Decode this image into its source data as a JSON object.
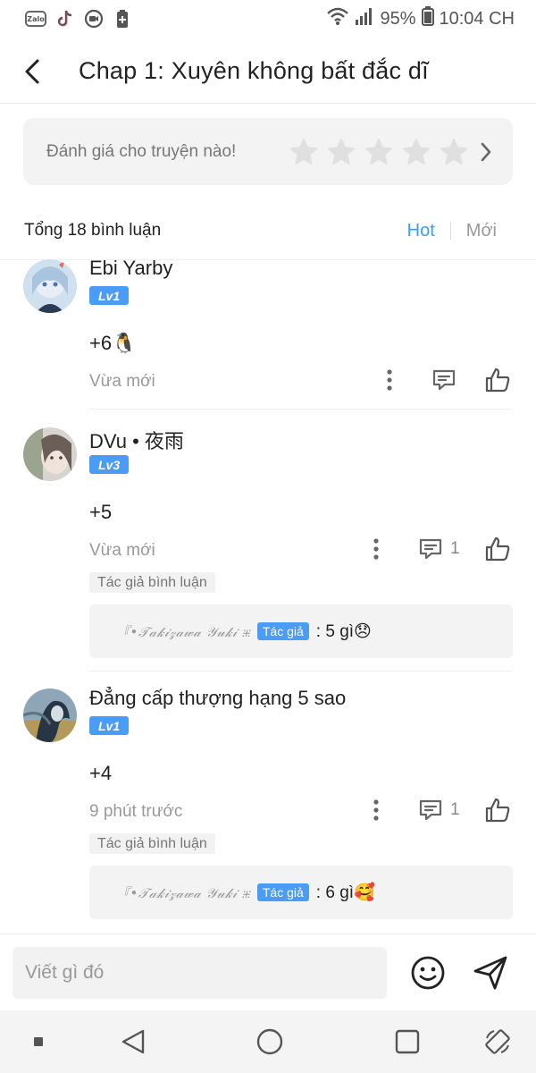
{
  "status_bar": {
    "zalo_label": "Zalo",
    "battery": "95%",
    "time": "10:04 CH"
  },
  "header": {
    "title": "Chap 1: Xuyên không bất đắc dĩ"
  },
  "rating": {
    "prompt": "Đánh giá cho truyện nào!",
    "stars_filled": 0,
    "stars_total": 5,
    "star_color": "#e0e0e0"
  },
  "comments_header": {
    "total_label": "Tổng 18 bình luận",
    "tabs": [
      {
        "label": "Hot",
        "active": true
      },
      {
        "label": "Mới",
        "active": false
      }
    ]
  },
  "comments": [
    {
      "name": "Ebi Yarby",
      "level": "Lv1",
      "body": "+6🐧",
      "time": "Vừa mới",
      "reply_count": ""
    },
    {
      "name": "DVu • 夜雨",
      "level": "Lv3",
      "body": "+5",
      "time": "Vừa mới",
      "reply_count": "1",
      "author_tag": "Tác giả bình luận",
      "reply": {
        "author": "『•𝒯𝒶𝓀𝒾𝓏𝒶𝓌𝒶 𝒴𝓊𝓀𝒾 ⁜",
        "badge": "Tác giả",
        "text": ": 5 gì😞"
      }
    },
    {
      "name": "Đẳng cấp thượng hạng 5 sao",
      "level": "Lv1",
      "body": "+4",
      "time": "9 phút trước",
      "reply_count": "1",
      "author_tag": "Tác giả bình luận",
      "reply": {
        "author": "『•𝒯𝒶𝓀𝒾𝓏𝒶𝓌𝒶 𝒴𝓊𝓀𝒾 ⁜",
        "badge": "Tác giả",
        "text": ": 6 gì🥰"
      }
    }
  ],
  "input": {
    "placeholder": "Viết gì đó"
  },
  "colors": {
    "accent": "#3b9ef0",
    "level_badge": "#4a9cf5"
  }
}
